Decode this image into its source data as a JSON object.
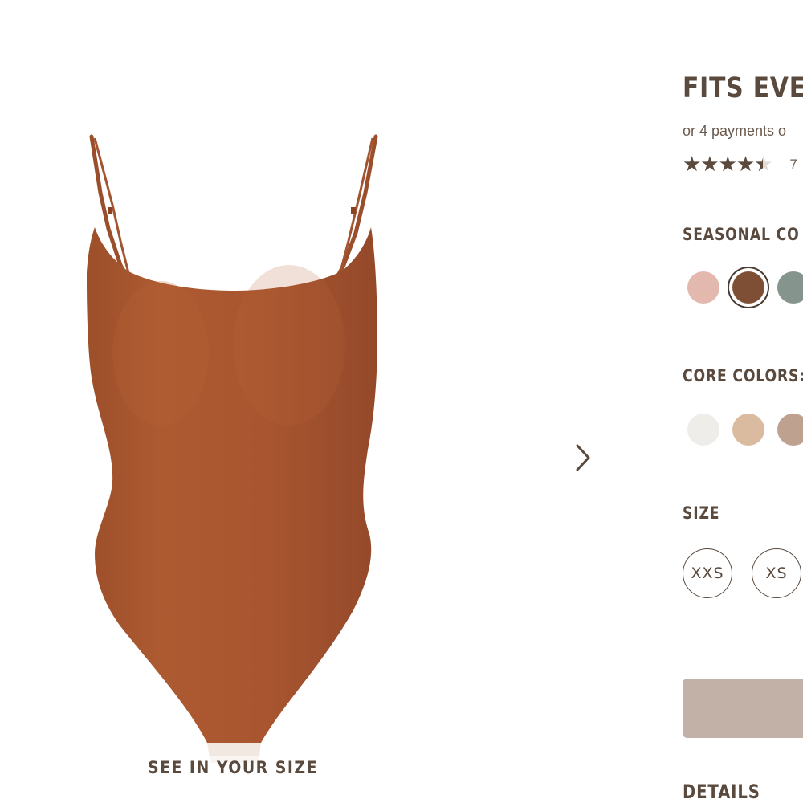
{
  "product": {
    "title": "FITS EVE",
    "payments_text": "or 4 payments o",
    "rating_value": 4.5,
    "rating_stars": "★★★★★",
    "review_count_partial": "7"
  },
  "gallery": {
    "see_size_label": "SEE IN YOUR SIZE",
    "next_icon": "chevron-right-icon",
    "garment_color": "#A8582F"
  },
  "seasonal": {
    "label": "SEASONAL CO",
    "swatches": [
      {
        "color": "#E3B8AE",
        "selected": false
      },
      {
        "color": "#7F4F35",
        "selected": true
      },
      {
        "color": "#86948E",
        "selected": false
      }
    ]
  },
  "core": {
    "label": "CORE COLORS:",
    "swatches": [
      {
        "color": "#EEEDEA"
      },
      {
        "color": "#DABBA0"
      },
      {
        "color": "#BFA190"
      }
    ]
  },
  "size": {
    "label": "SIZE",
    "options": [
      "XXS",
      "XS"
    ]
  },
  "details": {
    "label": "DETAILS"
  },
  "colors": {
    "text": "#5A4A3E",
    "add_button": "#C2B1A6"
  }
}
